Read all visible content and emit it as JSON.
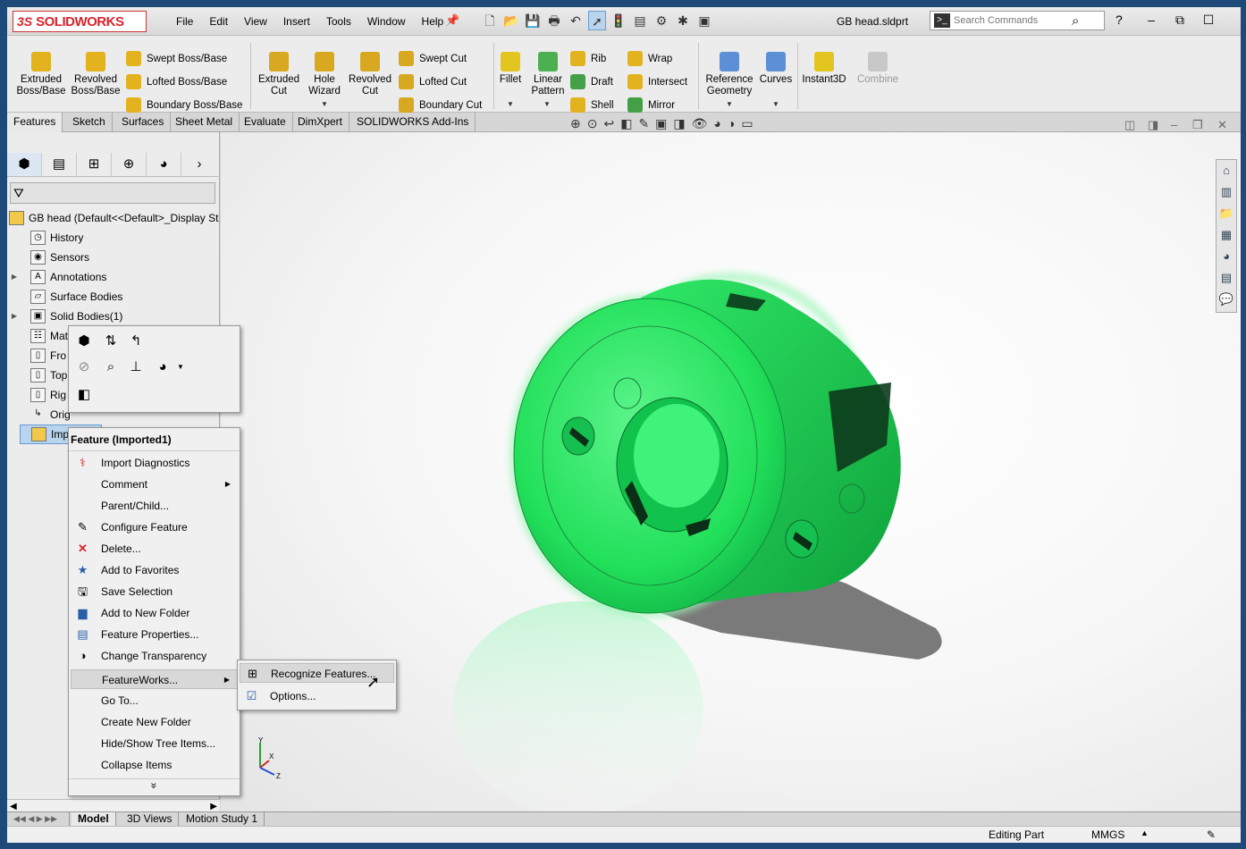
{
  "app": {
    "logo_ds": "3S",
    "logo_name": "SOLIDWORKS",
    "doc_title": "GB head.sldprt"
  },
  "menu": [
    "File",
    "Edit",
    "View",
    "Insert",
    "Tools",
    "Window",
    "Help"
  ],
  "search": {
    "placeholder": "Search Commands"
  },
  "ribbon": {
    "extruded_boss": "Extruded\nBoss/Base",
    "revolved_boss": "Revolved\nBoss/Base",
    "swept_boss": "Swept Boss/Base",
    "lofted_boss": "Lofted Boss/Base",
    "boundary_boss": "Boundary Boss/Base",
    "extruded_cut": "Extruded\nCut",
    "hole_wizard": "Hole\nWizard",
    "revolved_cut": "Revolved\nCut",
    "swept_cut": "Swept Cut",
    "lofted_cut": "Lofted Cut",
    "boundary_cut": "Boundary Cut",
    "fillet": "Fillet",
    "linear_pattern": "Linear\nPattern",
    "rib": "Rib",
    "draft": "Draft",
    "shell": "Shell",
    "wrap": "Wrap",
    "intersect": "Intersect",
    "mirror": "Mirror",
    "reference_geometry": "Reference\nGeometry",
    "curves": "Curves",
    "instant3d": "Instant3D",
    "combine": "Combine"
  },
  "tabs": [
    "Features",
    "Sketch",
    "Surfaces",
    "Sheet Metal",
    "Evaluate",
    "DimXpert",
    "SOLIDWORKS Add-Ins"
  ],
  "tree": {
    "root": "GB head  (Default<<Default>_Display St",
    "history": "History",
    "sensors": "Sensors",
    "annotations": "Annotations",
    "surface_bodies": "Surface Bodies",
    "solid_bodies": "Solid Bodies(1)",
    "material": "Mat",
    "front": "Fro",
    "top": "Top",
    "right": "Rig",
    "origin": "Orig",
    "imported": "Imp"
  },
  "context_menu": {
    "title": "Feature (Imported1)",
    "items": [
      {
        "label": "Import Diagnostics",
        "icon": "import-diagnostics-icon"
      },
      {
        "label": "Comment",
        "icon": "",
        "submenu": true
      },
      {
        "label": "Parent/Child...",
        "icon": ""
      },
      {
        "label": "Configure Feature",
        "icon": "configure-feature-icon"
      },
      {
        "label": "Delete...",
        "icon": "delete-icon"
      },
      {
        "label": "Add to Favorites",
        "icon": "favorites-icon"
      },
      {
        "label": "Save Selection",
        "icon": "save-selection-icon"
      },
      {
        "label": "Add to New Folder",
        "icon": "folder-icon"
      },
      {
        "label": "Feature Properties...",
        "icon": "properties-icon"
      },
      {
        "label": "Change Transparency",
        "icon": "transparency-icon"
      },
      {
        "label": "FeatureWorks...",
        "icon": "",
        "submenu": true
      },
      {
        "label": "Go To...",
        "icon": ""
      },
      {
        "label": "Create New Folder",
        "icon": ""
      },
      {
        "label": "Hide/Show Tree Items...",
        "icon": ""
      },
      {
        "label": "Collapse Items",
        "icon": ""
      }
    ],
    "more": "»"
  },
  "submenu": {
    "recognize": "Recognize Features...",
    "options": "Options..."
  },
  "bottom_tabs": [
    "Model",
    "3D Views",
    "Motion Study 1"
  ],
  "status": {
    "mode": "Editing Part",
    "units": "MMGS"
  },
  "triad": {
    "x": "X",
    "y": "Y",
    "z": "Z"
  },
  "colors": {
    "part_green": "#22e05a",
    "accent_red": "#d8232a",
    "highlight": "#b9d4ee"
  }
}
